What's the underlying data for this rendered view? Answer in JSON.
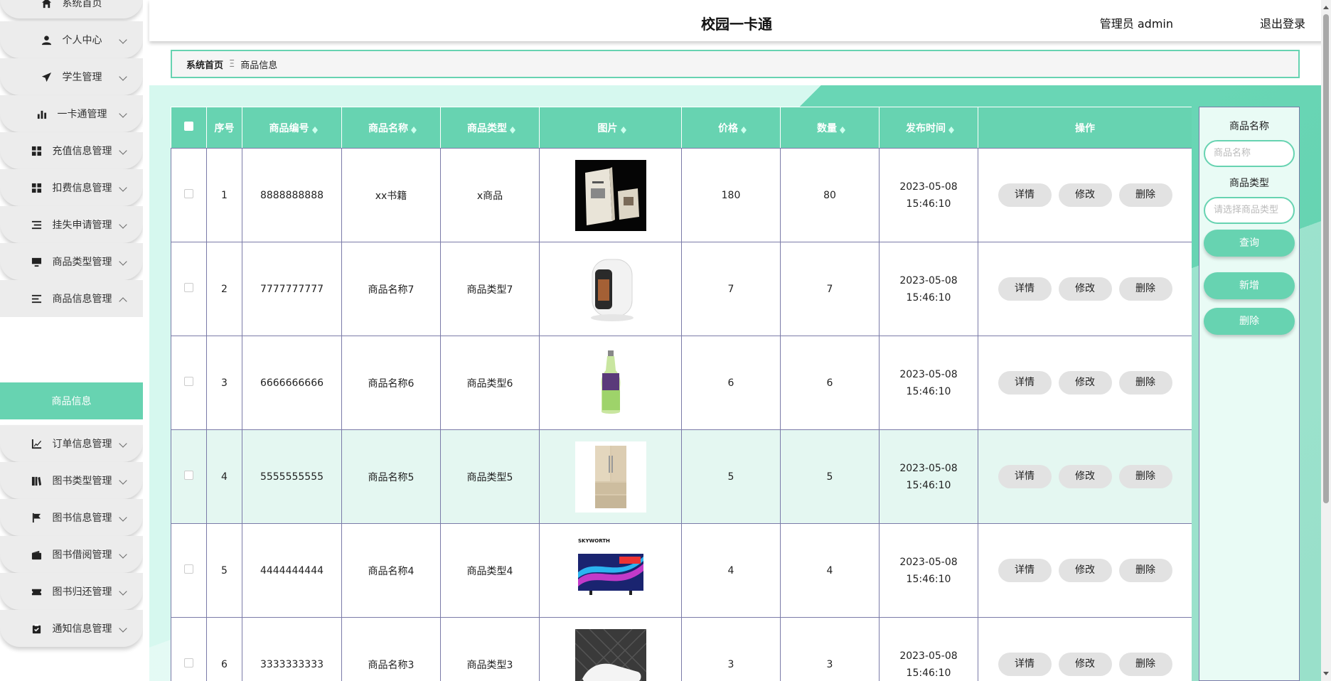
{
  "header": {
    "title": "校园一卡通",
    "user": "管理员 admin",
    "logout": "退出登录"
  },
  "breadcrumb": {
    "home": "系统首页",
    "separator": "Ξ",
    "current": "商品信息"
  },
  "sidebar": {
    "items": [
      {
        "label": "系统首页",
        "icon": "home-icon"
      },
      {
        "label": "个人中心",
        "icon": "user-icon"
      },
      {
        "label": "学生管理",
        "icon": "send-icon"
      },
      {
        "label": "一卡通管理",
        "icon": "bar-chart-icon"
      },
      {
        "label": "充值信息管理",
        "icon": "grid-icon"
      },
      {
        "label": "扣费信息管理",
        "icon": "grid-icon"
      },
      {
        "label": "挂失申请管理",
        "icon": "list-icon"
      },
      {
        "label": "商品类型管理",
        "icon": "monitor-icon"
      },
      {
        "label": "商品信息管理",
        "icon": "menu-icon"
      },
      {
        "label": "订单信息管理",
        "icon": "line-chart-icon"
      },
      {
        "label": "图书类型管理",
        "icon": "book-icon"
      },
      {
        "label": "图书信息管理",
        "icon": "flag-icon"
      },
      {
        "label": "图书借阅管理",
        "icon": "wallet-icon"
      },
      {
        "label": "图书归还管理",
        "icon": "ticket-icon"
      },
      {
        "label": "通知信息管理",
        "icon": "clipboard-icon"
      }
    ],
    "active_sub": "商品信息"
  },
  "table": {
    "columns": [
      "序号",
      "商品编号",
      "商品名称",
      "商品类型",
      "图片",
      "价格",
      "数量",
      "发布时间",
      "操作"
    ],
    "rows": [
      {
        "index": "1",
        "code": "8888888888",
        "name": "xx书籍",
        "type": "x商品",
        "image": "book-image",
        "price": "180",
        "qty": "80",
        "time": "2023-05-08 15:46:10"
      },
      {
        "index": "2",
        "code": "7777777777",
        "name": "商品名称7",
        "type": "商品类型7",
        "image": "heater-image",
        "price": "7",
        "qty": "7",
        "time": "2023-05-08 15:46:10"
      },
      {
        "index": "3",
        "code": "6666666666",
        "name": "商品名称6",
        "type": "商品类型6",
        "image": "bottle-image",
        "price": "6",
        "qty": "6",
        "time": "2023-05-08 15:46:10"
      },
      {
        "index": "4",
        "code": "5555555555",
        "name": "商品名称5",
        "type": "商品类型5",
        "image": "fridge-image",
        "price": "5",
        "qty": "5",
        "time": "2023-05-08 15:46:10"
      },
      {
        "index": "5",
        "code": "4444444444",
        "name": "商品名称4",
        "type": "商品类型4",
        "image": "tv-image",
        "price": "4",
        "qty": "4",
        "time": "2023-05-08 15:46:10"
      },
      {
        "index": "6",
        "code": "3333333333",
        "name": "商品名称3",
        "type": "商品类型3",
        "image": "shoe-image",
        "price": "3",
        "qty": "3",
        "time": "2023-05-08 15:46:10"
      }
    ],
    "actions": {
      "detail": "详情",
      "edit": "修改",
      "delete": "删除"
    }
  },
  "search": {
    "name_label": "商品名称",
    "name_placeholder": "商品名称",
    "type_label": "商品类型",
    "type_placeholder": "请选择商品类型",
    "query": "查询",
    "add": "新增",
    "delete": "删除"
  },
  "tv_brand": "SKYWORTH",
  "colors": {
    "accent": "#67d3b1",
    "light": "#e4f7f1"
  }
}
